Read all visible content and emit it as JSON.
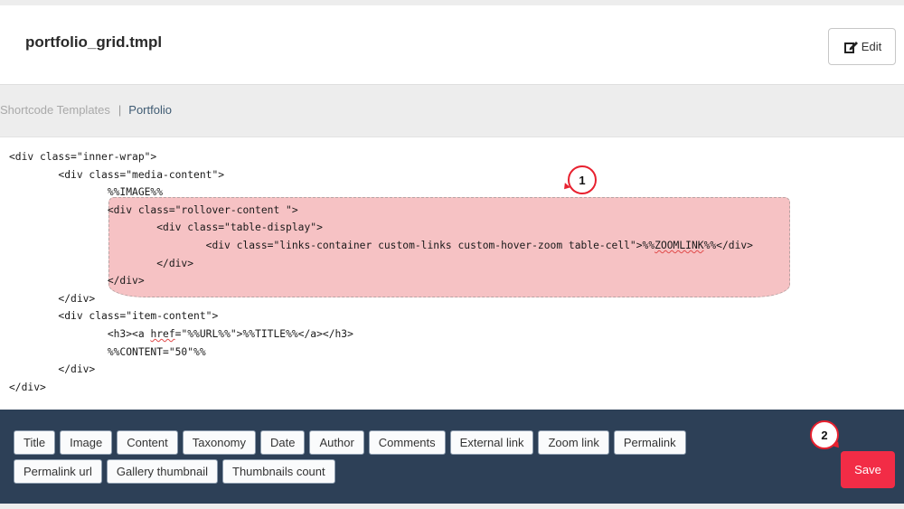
{
  "header": {
    "file_title": "portfolio_grid.tmpl",
    "edit_label": "Edit"
  },
  "breadcrumb": {
    "parent": "Shortcode Templates",
    "separator": "|",
    "current": "Portfolio"
  },
  "editor": {
    "lines": [
      "<div class=\"inner-wrap\">",
      "        <div class=\"media-content\">",
      "                %%IMAGE%%",
      "                <div class=\"rollover-content \">",
      "                        <div class=\"table-display\">",
      "                                <div class=\"links-container custom-links custom-hover-zoom table-cell\">%%ZOOMLINK%%</div>",
      "                        </div>",
      "                </div>",
      "        </div>",
      "        <div class=\"item-content\">",
      "                <h3><a href=\"%%URL%%\">%%TITLE%%</a></h3>",
      "                %%CONTENT=\"50\"%%",
      "        </div>",
      "</div>"
    ]
  },
  "callouts": {
    "one": "1",
    "two": "2"
  },
  "toolbar": {
    "row1": [
      "Title",
      "Image",
      "Content",
      "Taxonomy",
      "Date",
      "Author",
      "Comments",
      "External link",
      "Zoom link",
      "Permalink"
    ],
    "row2": [
      "Permalink url",
      "Gallery thumbnail",
      "Thumbnails count"
    ],
    "save_label": "Save"
  },
  "colors": {
    "toolbar_bg": "#2d4057",
    "save_bg": "#f22c46",
    "highlight": "#f3c1c3",
    "callout_border": "#e8212f"
  }
}
